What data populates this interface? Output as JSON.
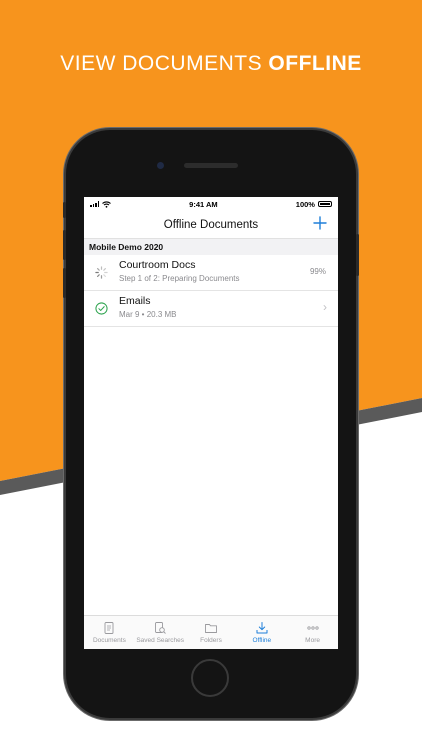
{
  "headline": {
    "normal": "VIEW DOCUMENTS ",
    "bold": "OFFLINE"
  },
  "colors": {
    "orange": "#F7941D",
    "band": "#5a5a5a",
    "accent": "#1E7FD9"
  },
  "status_bar": {
    "time": "9:41 AM",
    "battery": "100%"
  },
  "nav": {
    "title": "Offline Documents",
    "add_icon": "plus-icon"
  },
  "section": {
    "title": "Mobile Demo 2020"
  },
  "items": [
    {
      "title": "Courtroom Docs",
      "subtitle": "Step 1 of 2: Preparing Documents",
      "progress": "99%",
      "icon": "spinner-icon"
    },
    {
      "title": "Emails",
      "subtitle": "Mar 9 • 20.3 MB",
      "icon": "check-circle-icon"
    }
  ],
  "tabs": [
    {
      "label": "Documents",
      "icon": "document-icon"
    },
    {
      "label": "Saved Searches",
      "icon": "saved-search-icon"
    },
    {
      "label": "Folders",
      "icon": "folder-icon"
    },
    {
      "label": "Offline",
      "icon": "download-icon",
      "active": true
    },
    {
      "label": "More",
      "icon": "more-icon"
    }
  ]
}
